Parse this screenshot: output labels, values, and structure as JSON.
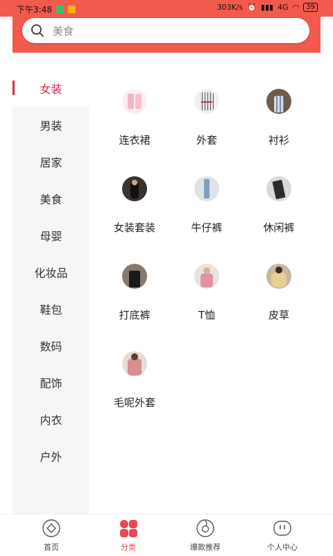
{
  "status_bar": {
    "time": "下午3:48",
    "speed": "303K/s",
    "network": "4G",
    "battery": "39"
  },
  "search": {
    "placeholder": "美食",
    "icon": "search-icon"
  },
  "sidebar": {
    "items": [
      {
        "label": "女装",
        "active": true
      },
      {
        "label": "男装"
      },
      {
        "label": "居家"
      },
      {
        "label": "美食"
      },
      {
        "label": "母婴"
      },
      {
        "label": "化妆品"
      },
      {
        "label": "鞋包"
      },
      {
        "label": "数码"
      },
      {
        "label": "配饰"
      },
      {
        "label": "内衣"
      },
      {
        "label": "户外"
      }
    ]
  },
  "categories": [
    {
      "label": "连衣裙"
    },
    {
      "label": "外套"
    },
    {
      "label": "衬衫"
    },
    {
      "label": "女装套装"
    },
    {
      "label": "牛仔裤"
    },
    {
      "label": "休闲裤"
    },
    {
      "label": "打底裤"
    },
    {
      "label": "T恤"
    },
    {
      "label": "皮草"
    },
    {
      "label": "毛呢外套"
    }
  ],
  "tabbar": {
    "items": [
      {
        "label": "首页",
        "icon": "home-icon"
      },
      {
        "label": "分类",
        "icon": "category-icon",
        "active": true
      },
      {
        "label": "爆款推荐",
        "icon": "recommend-icon"
      },
      {
        "label": "个人中心",
        "icon": "profile-icon"
      }
    ]
  },
  "colors": {
    "brand": "#f25a4d",
    "accent": "#d8274a",
    "tab_active": "#e8485a"
  }
}
